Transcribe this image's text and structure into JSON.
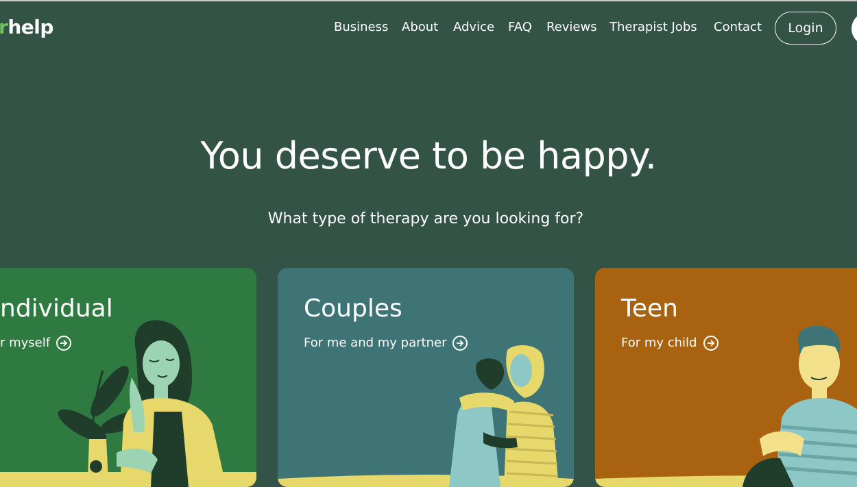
{
  "logo": {
    "accent": "r",
    "text": "help"
  },
  "nav": {
    "items": [
      "Business",
      "About",
      "Advice",
      "FAQ",
      "Reviews",
      "Therapist Jobs",
      "Contact"
    ],
    "login_label": "Login"
  },
  "hero": {
    "title": "You deserve to be happy.",
    "subtitle": "What type of therapy are you looking for?"
  },
  "cards": [
    {
      "title": "ndividual",
      "link": "r myself",
      "color": "#2f7a41"
    },
    {
      "title": "Couples",
      "link": "For me and my partner",
      "color": "#3e7476"
    },
    {
      "title": "Teen",
      "link": "For my child",
      "color": "#a86210"
    }
  ],
  "colors": {
    "background": "#325345",
    "accent_green": "#6fc35a"
  },
  "icons": {
    "card_link": "arrow-right-circle-icon"
  }
}
